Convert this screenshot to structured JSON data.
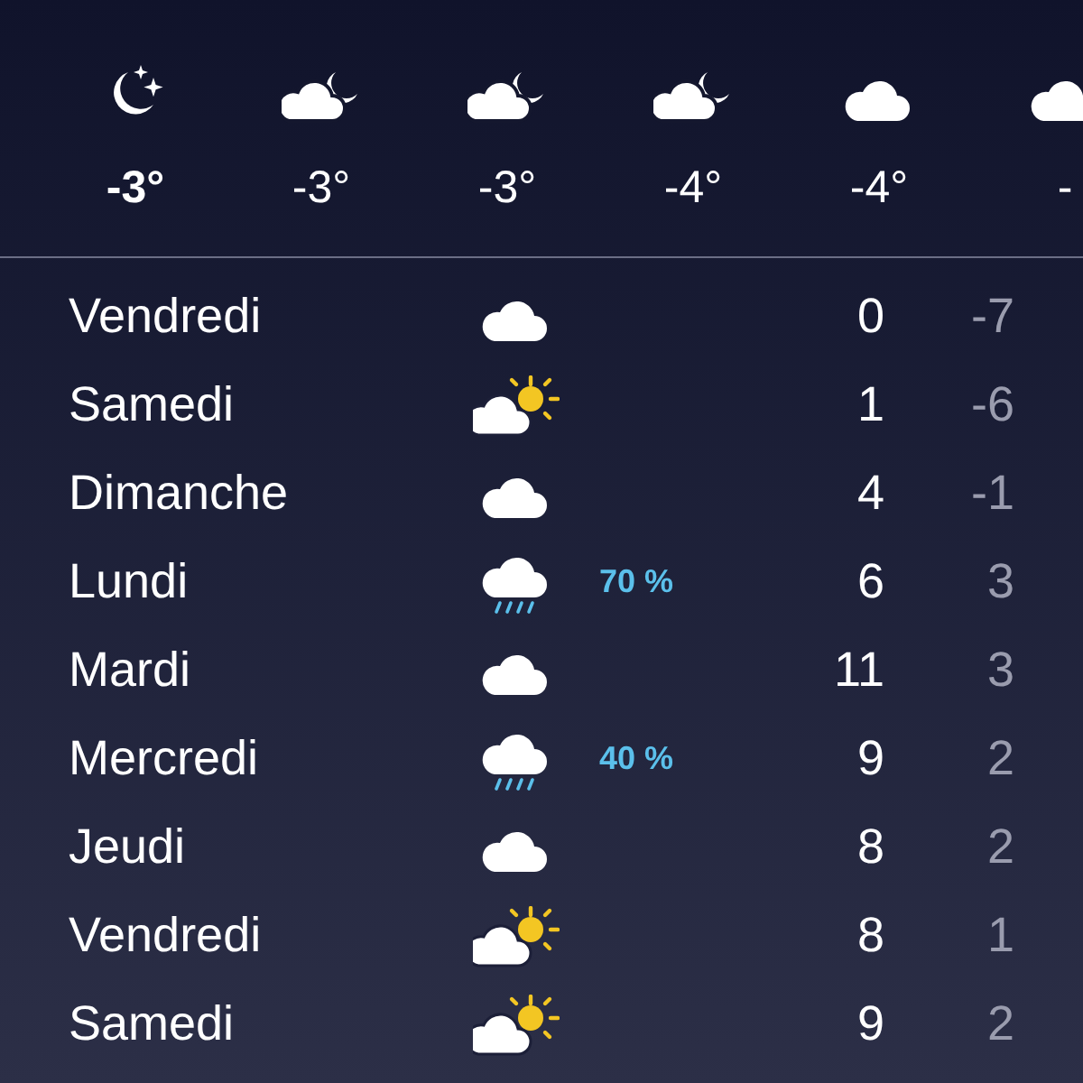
{
  "hourly": [
    {
      "kind": "moon",
      "temp": "-3°",
      "current": true
    },
    {
      "kind": "mooncloud",
      "temp": "-3°",
      "current": false
    },
    {
      "kind": "mooncloud",
      "temp": "-3°",
      "current": false
    },
    {
      "kind": "mooncloud",
      "temp": "-4°",
      "current": false
    },
    {
      "kind": "cloud",
      "temp": "-4°",
      "current": false
    },
    {
      "kind": "cloud",
      "temp": "-",
      "current": false
    }
  ],
  "daily": [
    {
      "day": "Vendredi",
      "kind": "cloud",
      "high": "0",
      "low": "-7"
    },
    {
      "day": "Samedi",
      "kind": "suncloud",
      "high": "1",
      "low": "-6"
    },
    {
      "day": "Dimanche",
      "kind": "cloud",
      "high": "4",
      "low": "-1"
    },
    {
      "day": "Lundi",
      "kind": "rain",
      "precip": "70 %",
      "high": "6",
      "low": "3"
    },
    {
      "day": "Mardi",
      "kind": "cloud",
      "high": "11",
      "low": "3"
    },
    {
      "day": "Mercredi",
      "kind": "rain",
      "precip": "40 %",
      "high": "9",
      "low": "2"
    },
    {
      "day": "Jeudi",
      "kind": "cloud",
      "high": "8",
      "low": "2"
    },
    {
      "day": "Vendredi",
      "kind": "suncloud",
      "high": "8",
      "low": "1"
    },
    {
      "day": "Samedi",
      "kind": "suncloud",
      "high": "9",
      "low": "2"
    }
  ]
}
